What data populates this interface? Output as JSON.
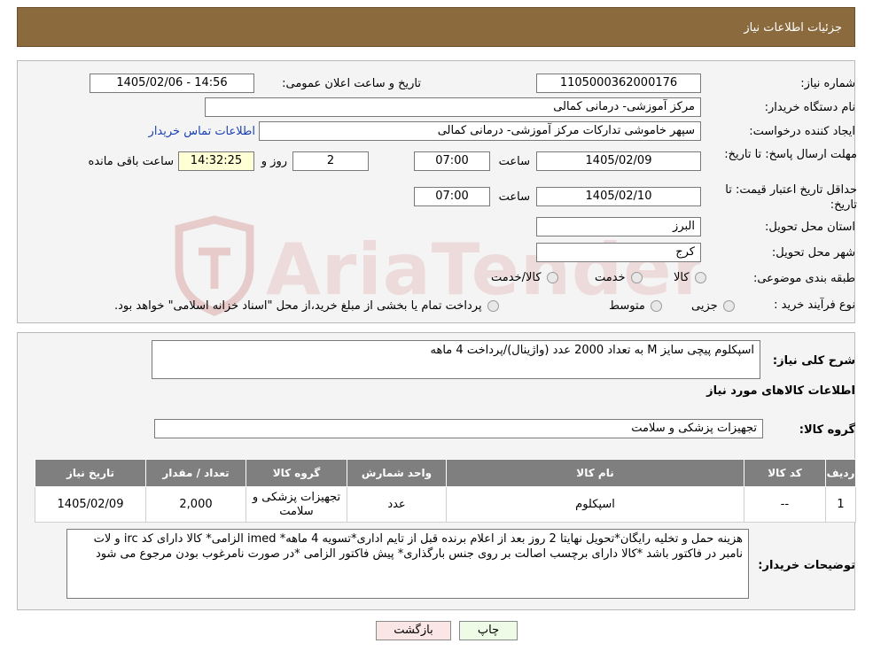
{
  "header": {
    "title": "جزئیات اطلاعات نیاز"
  },
  "watermark": {
    "text": "AriaTender.neT"
  },
  "form": {
    "need_number": {
      "label": "شماره نیاز:",
      "value": "1105000362000176"
    },
    "announce": {
      "label": "تاریخ و ساعت اعلان عمومی:",
      "value": "1405/02/06 - 14:56"
    },
    "buyer_org": {
      "label": "نام دستگاه خریدار:",
      "value": "مرکز آموزشی- درمانی کمالی"
    },
    "requester": {
      "label": "ایجاد کننده درخواست:",
      "value": "سپهر خاموشی تدارکات مرکز آموزشی- درمانی کمالی",
      "contact_link": "اطلاعات تماس خریدار"
    },
    "reply_deadline": {
      "label": "مهلت ارسال پاسخ: تا تاریخ:",
      "date": "1405/02/09",
      "time_label": "ساعت",
      "time": "07:00",
      "days": "2",
      "days_label": "روز و",
      "remaining": "14:32:25",
      "remaining_label": "ساعت باقی مانده"
    },
    "price_validity": {
      "label": "حداقل تاریخ اعتبار قیمت: تا تاریخ:",
      "date": "1405/02/10",
      "time_label": "ساعت",
      "time": "07:00"
    },
    "province": {
      "label": "استان محل تحویل:",
      "value": "البرز"
    },
    "city": {
      "label": "شهر محل تحویل:",
      "value": "کرج"
    },
    "category": {
      "label": "طبقه بندی موضوعی:",
      "options": [
        "کالا",
        "خدمت",
        "کالا/خدمت"
      ]
    },
    "purchase_type": {
      "label": "نوع فرآیند خرید :",
      "options": [
        "جزیی",
        "متوسط"
      ],
      "note": "پرداخت تمام یا بخشی از مبلغ خرید،از محل \"اسناد خزانه اسلامی\" خواهد بود."
    }
  },
  "summary": {
    "label": "شرح کلی نیاز:",
    "value": "اسپکلوم پیچی سایز M به تعداد 2000 عدد (واژینال)/پرداخت 4 ماهه"
  },
  "goods_title": "اطلاعات کالاهای مورد نیاز",
  "goods_group": {
    "label": "گروه کالا:",
    "value": "تجهیزات پزشکی و سلامت"
  },
  "table": {
    "headers": [
      "ردیف",
      "کد کالا",
      "نام کالا",
      "واحد شمارش",
      "گروه کالا",
      "تعداد / مقدار",
      "تاریخ نیاز"
    ],
    "rows": [
      [
        "1",
        "--",
        "اسپکلوم",
        "عدد",
        "تجهیزات پزشکی و سلامت",
        "2,000",
        "1405/02/09"
      ]
    ]
  },
  "buyer_notes": {
    "label": "توضیحات خریدار:",
    "value": "هزینه حمل و تخلیه رایگان*تحویل نهایتا 2 روز بعد از اعلام برنده قبل از تایم اداری*تسویه 4 ماهه* imed الزامی* کالا دارای کد irc و لات نامبر در فاکتور باشد *کالا دارای برچسب اصالت بر روی جنس بارگذاری* پیش فاکتور الزامی *در صورت نامرغوب بودن مرجوع می شود"
  },
  "buttons": {
    "print": "چاپ",
    "back": "بازگشت"
  },
  "colors": {
    "header_bg": "#8b6a3e",
    "table_header_bg": "#7f7f7f",
    "print_btn_bg": "#eefbe6",
    "back_btn_bg": "#fbe6e6"
  }
}
